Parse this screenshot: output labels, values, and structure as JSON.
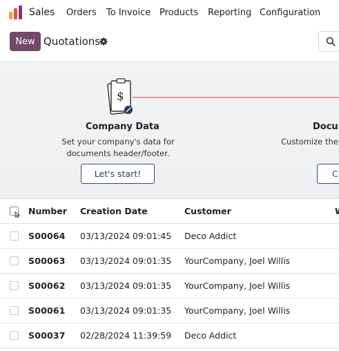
{
  "navbar": {
    "app_name": "Sales",
    "items": [
      {
        "label": "Orders"
      },
      {
        "label": "To Invoice"
      },
      {
        "label": "Products"
      },
      {
        "label": "Reporting"
      },
      {
        "label": "Configuration"
      }
    ],
    "logo_colors": [
      "#f1a33b",
      "#e5533b",
      "#7a3a83"
    ]
  },
  "control": {
    "new_label": "New",
    "breadcrumb": "Quotations",
    "new_color": "#714b67"
  },
  "onboarding": {
    "steps": [
      {
        "title": "Company Data",
        "desc_line1": "Set your company's data for",
        "desc_line2": "documents header/footer.",
        "button": "Let's start!"
      },
      {
        "title": "Docu",
        "desc_line1": "Customize the l",
        "button": "C"
      }
    ]
  },
  "table": {
    "headers": {
      "number": "Number",
      "creation_date": "Creation Date",
      "customer": "Customer",
      "extra": "W"
    },
    "rows": [
      {
        "number": "S00064",
        "date": "03/13/2024 09:01:45",
        "customer": "Deco Addict"
      },
      {
        "number": "S00063",
        "date": "03/13/2024 09:01:35",
        "customer": "YourCompany, Joel Willis"
      },
      {
        "number": "S00062",
        "date": "03/13/2024 09:01:35",
        "customer": "YourCompany, Joel Willis"
      },
      {
        "number": "S00061",
        "date": "03/13/2024 09:01:35",
        "customer": "YourCompany, Joel Willis"
      },
      {
        "number": "S00037",
        "date": "02/28/2024 11:39:59",
        "customer": "Deco Addict"
      }
    ]
  }
}
